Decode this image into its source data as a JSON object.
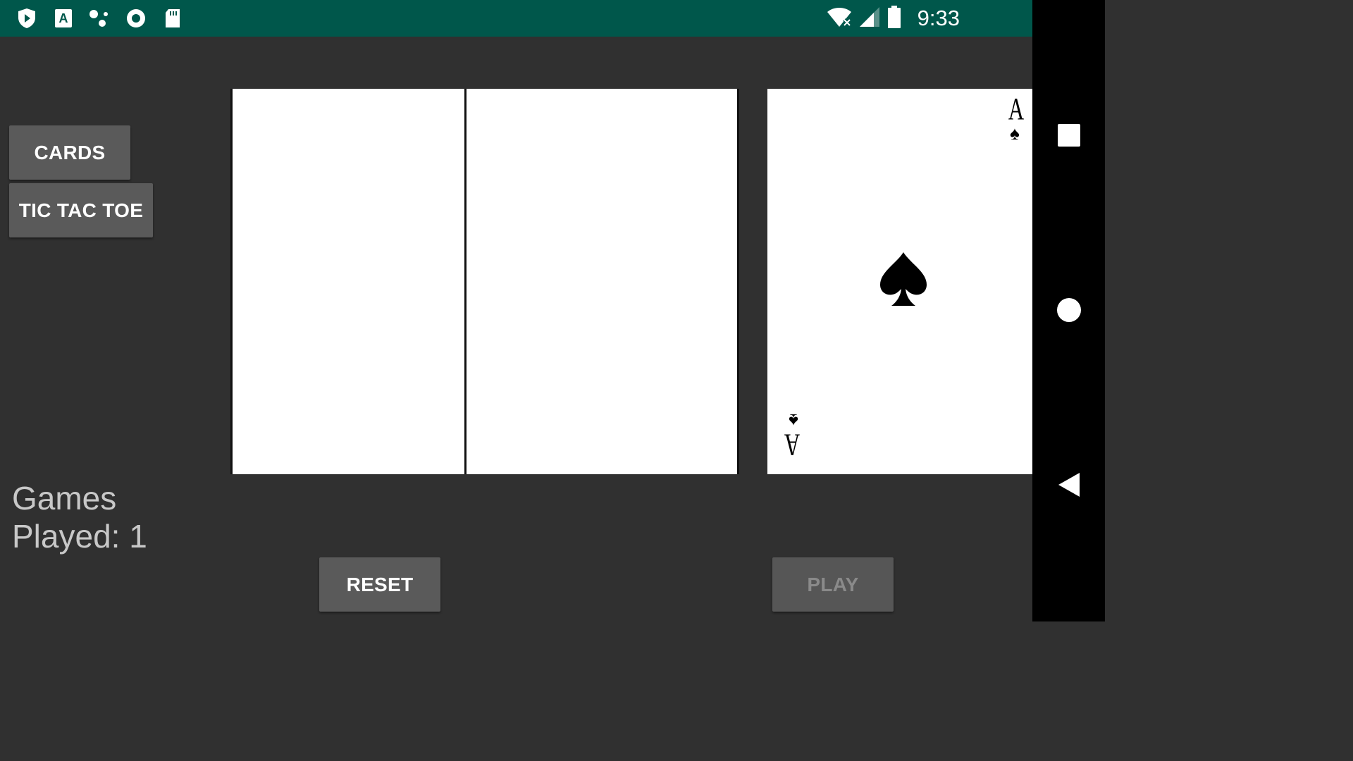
{
  "status_bar": {
    "time": "9:33",
    "left_icons": [
      "play-protect-icon",
      "keyboard-a-icon",
      "dots-icon",
      "radio-icon",
      "sd-card-icon"
    ],
    "right_icons": [
      "wifi-off-icon",
      "signal-icon",
      "battery-icon"
    ],
    "color": "#00574B"
  },
  "menu": {
    "cards_label": "CARDS",
    "tictactoe_label": "TIC TAC TOE"
  },
  "cards": {
    "left": "face-down",
    "middle": "face-down",
    "right": {
      "rank": "A",
      "suit": "♠"
    }
  },
  "stats": {
    "line1": "Games",
    "line2": "Played: 1"
  },
  "controls": {
    "reset_label": "RESET",
    "play_label": "PLAY"
  },
  "nav_bar": {
    "icons": [
      "recents-square-icon",
      "home-circle-icon",
      "back-triangle-icon"
    ]
  }
}
